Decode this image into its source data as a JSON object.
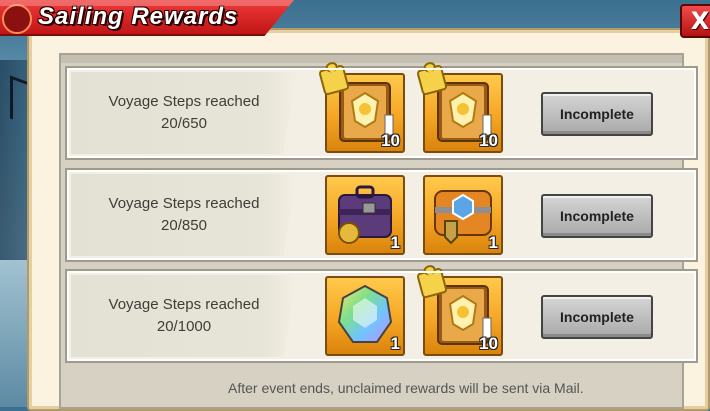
{
  "window": {
    "title": "Sailing Rewards",
    "close_label": "X"
  },
  "rows": [
    {
      "label": "Voyage Steps reached",
      "progress": "20/650",
      "items": [
        {
          "icon": "gear-book-icon",
          "count": "10",
          "puzzle": true
        },
        {
          "icon": "gear-book-icon",
          "count": "10",
          "puzzle": true
        }
      ],
      "button": "Incomplete"
    },
    {
      "label": "Voyage Steps reached",
      "progress": "20/850",
      "items": [
        {
          "icon": "purple-chest-icon",
          "count": "1",
          "puzzle": false
        },
        {
          "icon": "orange-chest-icon",
          "count": "1",
          "puzzle": false
        }
      ],
      "button": "Incomplete"
    },
    {
      "label": "Voyage Steps reached",
      "progress": "20/1000",
      "items": [
        {
          "icon": "rainbow-gem-icon",
          "count": "1",
          "puzzle": false
        },
        {
          "icon": "gear-book-icon",
          "count": "10",
          "puzzle": true
        }
      ],
      "button": "Incomplete"
    }
  ],
  "footer": "After event ends, unclaimed rewards will be sent via Mail."
}
